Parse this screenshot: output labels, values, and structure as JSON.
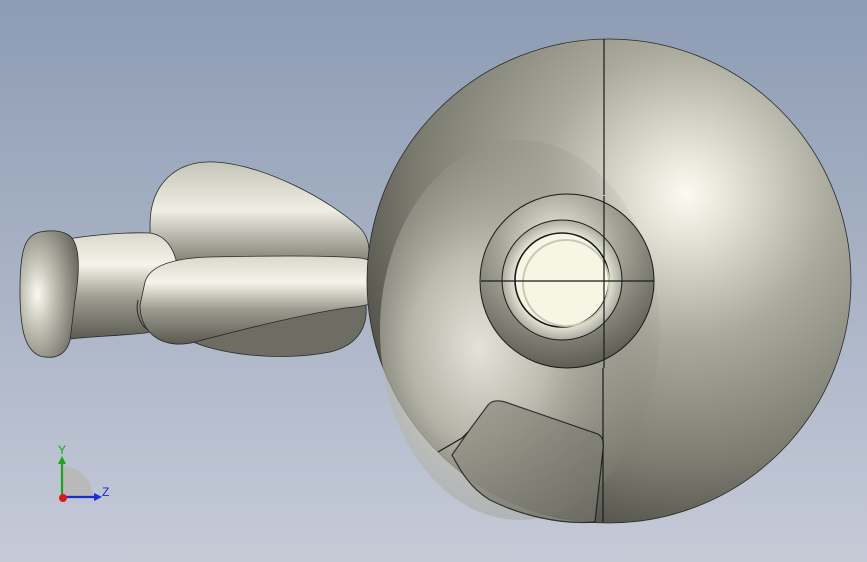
{
  "viewport": {
    "background_top": "#8d9cb4",
    "background_bottom": "#c3c9d6"
  },
  "model": {
    "body_color": "#a8a89a",
    "highlight_color": "#fbfbf2",
    "edge_color": "#1a1a1a",
    "lens_face_color": "#f6f6e4"
  },
  "triad": {
    "y_label": "Y",
    "z_label": "Z",
    "y_color": "#1aa81a",
    "z_color": "#1a2bd8",
    "x_color": "#d81a1a"
  }
}
